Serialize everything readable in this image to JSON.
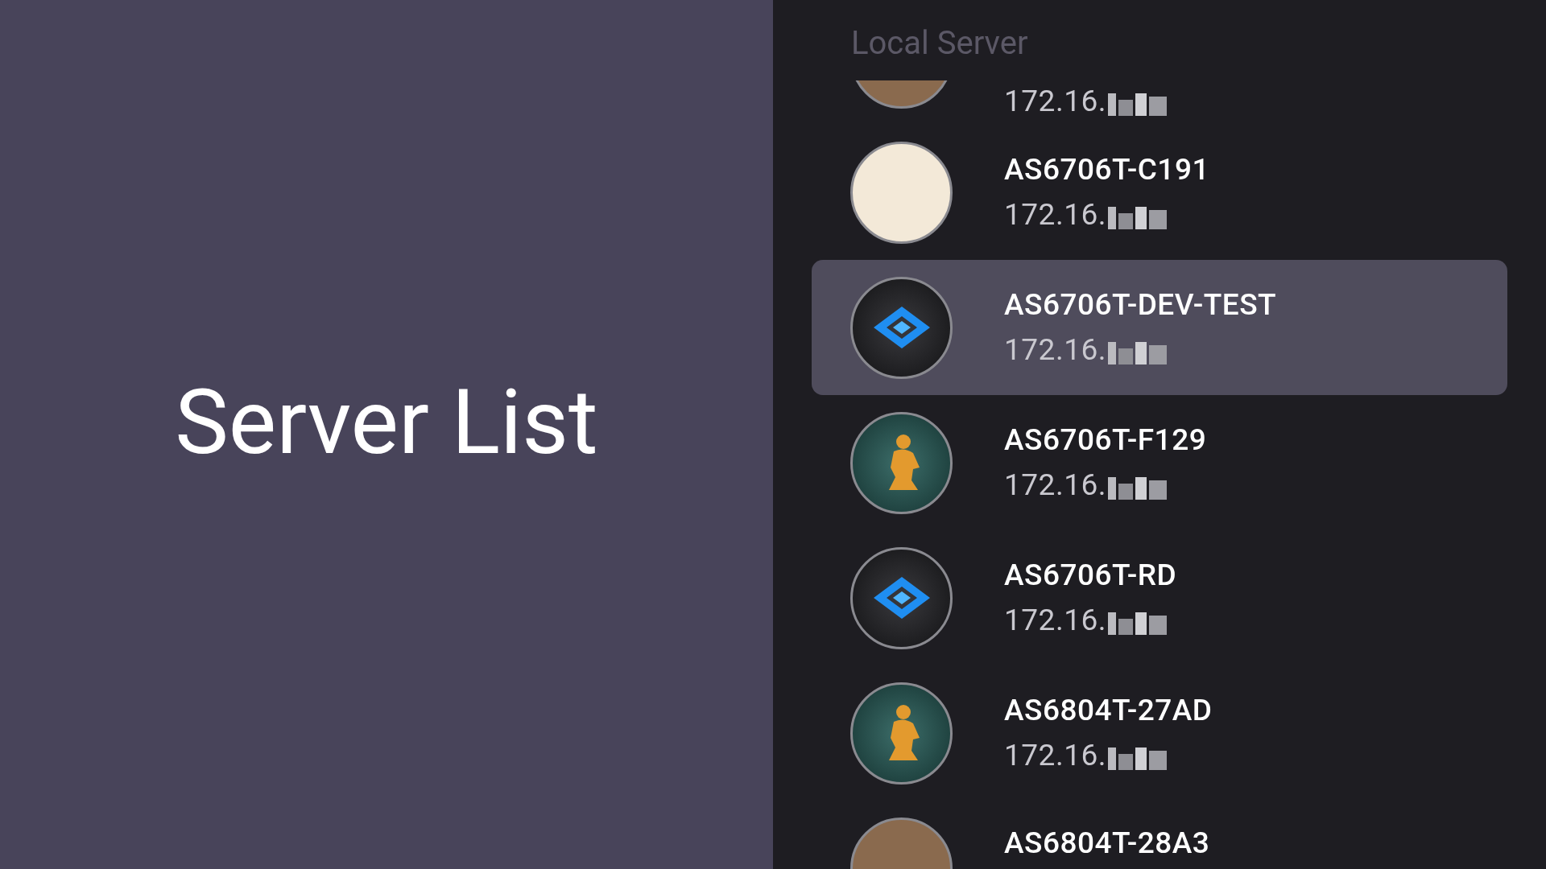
{
  "title": "Server List",
  "list": {
    "heading": "Local Server",
    "servers": [
      {
        "ip": "172.16.",
        "selected": false,
        "avatar": {
          "kind": "photo"
        }
      },
      {
        "name": "AS6706T-C191",
        "ip": "172.16.",
        "selected": false,
        "avatar": {
          "kind": "photo"
        }
      },
      {
        "name": "AS6706T-DEV-TEST",
        "ip": "172.16.",
        "selected": true,
        "avatar": {
          "kind": "logo"
        }
      },
      {
        "name": "AS6706T-F129",
        "ip": "172.16.",
        "selected": false,
        "avatar": {
          "kind": "figure"
        }
      },
      {
        "name": "AS6706T-RD",
        "ip": "172.16.",
        "selected": false,
        "avatar": {
          "kind": "logo"
        }
      },
      {
        "name": "AS6804T-27AD",
        "ip": "172.16.",
        "selected": false,
        "avatar": {
          "kind": "figure"
        }
      },
      {
        "name": "AS6804T-28A3",
        "selected": false,
        "avatar": {
          "kind": "photo"
        }
      }
    ]
  }
}
